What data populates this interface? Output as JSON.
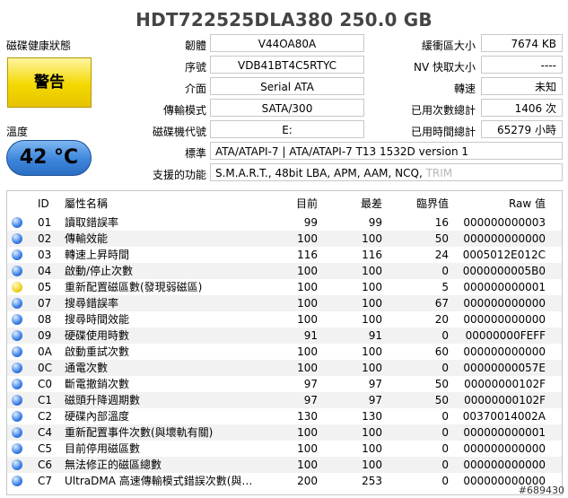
{
  "title": "HDT722525DLA380  250.0 GB",
  "health": {
    "label": "磁碟健康狀態",
    "status": "警告",
    "status_color": "#f3d800"
  },
  "temperature": {
    "label": "溫度",
    "value": "42 °C",
    "color": "#3d86dd"
  },
  "info": {
    "firmware": {
      "label": "韌體",
      "value": "V44OA80A"
    },
    "serial": {
      "label": "序號",
      "value": "VDB41BT4C5RTYC"
    },
    "interface": {
      "label": "介面",
      "value": "Serial ATA"
    },
    "transfer": {
      "label": "傳輸模式",
      "value": "SATA/300"
    },
    "drive_letter": {
      "label": "磁碟機代號",
      "value": "E:"
    },
    "buffer": {
      "label": "緩衝區大小",
      "value": "7674 KB"
    },
    "nv_cache": {
      "label": "NV 快取大小",
      "value": "----"
    },
    "rotation": {
      "label": "轉速",
      "value": "未知"
    },
    "power_on_count": {
      "label": "已用次數總計",
      "value": "1406 次"
    },
    "power_on_hours": {
      "label": "已用時間總計",
      "value": "65279 小時"
    },
    "standard": {
      "label": "標準",
      "value": "ATA/ATAPI-7 | ATA/ATAPI-7 T13 1532D version 1"
    },
    "features": {
      "label": "支援的功能",
      "value": "S.M.A.R.T., 48bit LBA, APM, AAM, NCQ,",
      "value_disabled": "TRIM"
    }
  },
  "table": {
    "headers": {
      "id": "ID",
      "name": "屬性名稱",
      "current": "目前",
      "worst": "最差",
      "threshold": "臨界值",
      "raw": "Raw 值"
    },
    "rows": [
      {
        "status": "blue",
        "id": "01",
        "name": "讀取錯誤率",
        "current": "99",
        "worst": "99",
        "threshold": "16",
        "raw": "000000000003"
      },
      {
        "status": "blue",
        "id": "02",
        "name": "傳輸效能",
        "current": "100",
        "worst": "100",
        "threshold": "50",
        "raw": "000000000000"
      },
      {
        "status": "blue",
        "id": "03",
        "name": "轉速上昇時間",
        "current": "116",
        "worst": "116",
        "threshold": "24",
        "raw": "0005012E012C"
      },
      {
        "status": "blue",
        "id": "04",
        "name": "啟動/停止次數",
        "current": "100",
        "worst": "100",
        "threshold": "0",
        "raw": "0000000005B0"
      },
      {
        "status": "yellow",
        "id": "05",
        "name": "重新配置磁區數(發現弱磁區)",
        "current": "100",
        "worst": "100",
        "threshold": "5",
        "raw": "000000000001"
      },
      {
        "status": "blue",
        "id": "07",
        "name": "搜尋錯誤率",
        "current": "100",
        "worst": "100",
        "threshold": "67",
        "raw": "000000000000"
      },
      {
        "status": "blue",
        "id": "08",
        "name": "搜尋時間效能",
        "current": "100",
        "worst": "100",
        "threshold": "20",
        "raw": "000000000000"
      },
      {
        "status": "blue",
        "id": "09",
        "name": "硬碟使用時數",
        "current": "91",
        "worst": "91",
        "threshold": "0",
        "raw": "00000000FEFF"
      },
      {
        "status": "blue",
        "id": "0A",
        "name": "啟動重試次數",
        "current": "100",
        "worst": "100",
        "threshold": "60",
        "raw": "000000000000"
      },
      {
        "status": "blue",
        "id": "0C",
        "name": "通電次數",
        "current": "100",
        "worst": "100",
        "threshold": "0",
        "raw": "00000000057E"
      },
      {
        "status": "blue",
        "id": "C0",
        "name": "斷電撤銷次數",
        "current": "97",
        "worst": "97",
        "threshold": "50",
        "raw": "00000000102F"
      },
      {
        "status": "blue",
        "id": "C1",
        "name": "磁頭升降週期數",
        "current": "97",
        "worst": "97",
        "threshold": "50",
        "raw": "00000000102F"
      },
      {
        "status": "blue",
        "id": "C2",
        "name": "硬碟內部溫度",
        "current": "130",
        "worst": "130",
        "threshold": "0",
        "raw": "00370014002A"
      },
      {
        "status": "blue",
        "id": "C4",
        "name": "重新配置事件次數(與壞軌有關)",
        "current": "100",
        "worst": "100",
        "threshold": "0",
        "raw": "000000000001"
      },
      {
        "status": "blue",
        "id": "C5",
        "name": "目前停用磁區數",
        "current": "100",
        "worst": "100",
        "threshold": "0",
        "raw": "000000000000"
      },
      {
        "status": "blue",
        "id": "C6",
        "name": "無法修正的磁區總數",
        "current": "100",
        "worst": "100",
        "threshold": "0",
        "raw": "000000000000"
      },
      {
        "status": "blue",
        "id": "C7",
        "name": "UltraDMA 高速傳輸模式錯誤次數(與…",
        "current": "200",
        "worst": "253",
        "threshold": "0",
        "raw": "000000000000"
      }
    ]
  },
  "watermark": "#689430"
}
